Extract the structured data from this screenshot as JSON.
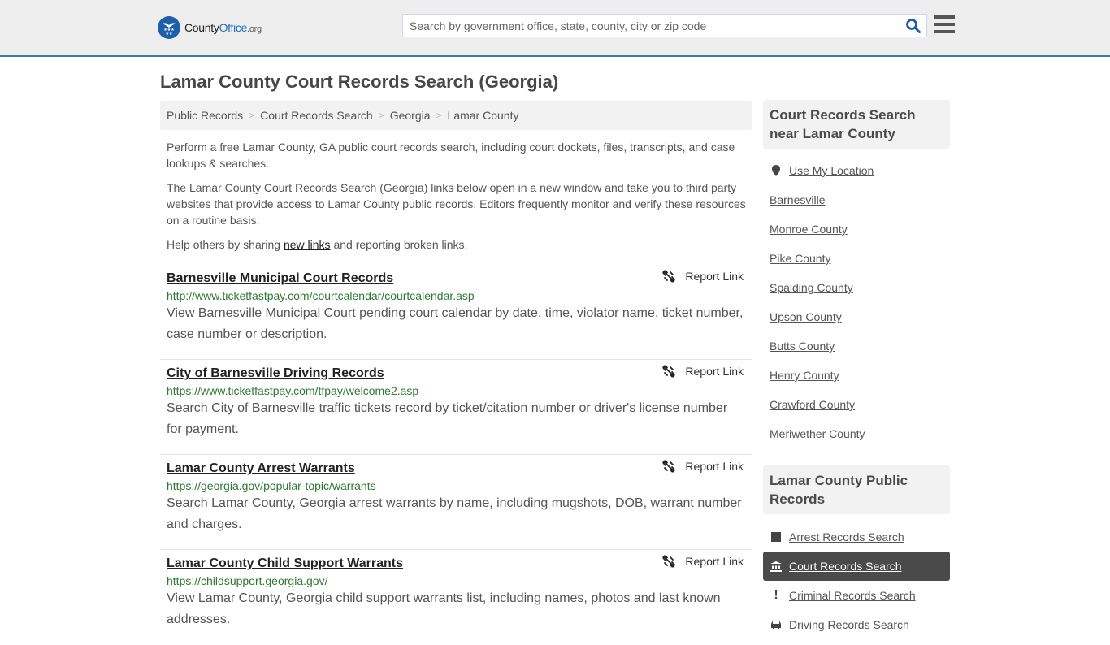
{
  "header": {
    "logo": {
      "brand_part1": "County",
      "brand_part2": "Office",
      "brand_tld": ".org"
    },
    "search": {
      "placeholder": "Search by government office, state, county, city or zip code",
      "value": ""
    },
    "colors": {
      "accent": "#3a7aab",
      "brand_blue": "#1d5fa8"
    }
  },
  "page": {
    "title": "Lamar County Court Records Search (Georgia)",
    "breadcrumb": [
      "Public Records",
      "Court Records Search",
      "Georgia",
      "Lamar County"
    ],
    "intro": {
      "p1": "Perform a free Lamar County, GA public court records search, including court dockets, files, transcripts, and case lookups & searches.",
      "p2": "The Lamar County Court Records Search (Georgia) links below open in a new window and take you to third party websites that provide access to Lamar County public records. Editors frequently monitor and verify these resources on a routine basis.",
      "p3_before": "Help others by sharing ",
      "p3_link": "new links",
      "p3_after": " and reporting broken links."
    }
  },
  "results": [
    {
      "title": "Barnesville Municipal Court Records",
      "url": "http://www.ticketfastpay.com/courtcalendar/courtcalendar.asp",
      "description": "View Barnesville Municipal Court pending court calendar by date, time, violator name, ticket number, case number or description.",
      "report_label": "Report Link"
    },
    {
      "title": "City of Barnesville Driving Records",
      "url": "https://www.ticketfastpay.com/tfpay/welcome2.asp",
      "description": "Search City of Barnesville traffic tickets record by ticket/citation number or driver's license number for payment.",
      "report_label": "Report Link"
    },
    {
      "title": "Lamar County Arrest Warrants",
      "url": "https://georgia.gov/popular-topic/warrants",
      "description": "Search Lamar County, Georgia arrest warrants by name, including mugshots, DOB, warrant number and charges.",
      "report_label": "Report Link"
    },
    {
      "title": "Lamar County Child Support Warrants",
      "url": "https://childsupport.georgia.gov/",
      "description": "View Lamar County, Georgia child support warrants list, including names, photos and last known addresses.",
      "report_label": "Report Link"
    }
  ],
  "sidebar": {
    "nearby": {
      "heading": "Court Records Search near Lamar County",
      "use_location": "Use My Location",
      "items": [
        "Barnesville",
        "Monroe County",
        "Pike County",
        "Spalding County",
        "Upson County",
        "Butts County",
        "Henry County",
        "Crawford County",
        "Meriwether County"
      ]
    },
    "public_records": {
      "heading": "Lamar County Public Records",
      "items": [
        {
          "label": "Arrest Records Search",
          "icon": "square-icon",
          "active": false
        },
        {
          "label": "Court Records Search",
          "icon": "courthouse-icon",
          "active": true
        },
        {
          "label": "Criminal Records Search",
          "icon": "exclamation-icon",
          "active": false
        },
        {
          "label": "Driving Records Search",
          "icon": "car-icon",
          "active": false
        }
      ]
    }
  }
}
